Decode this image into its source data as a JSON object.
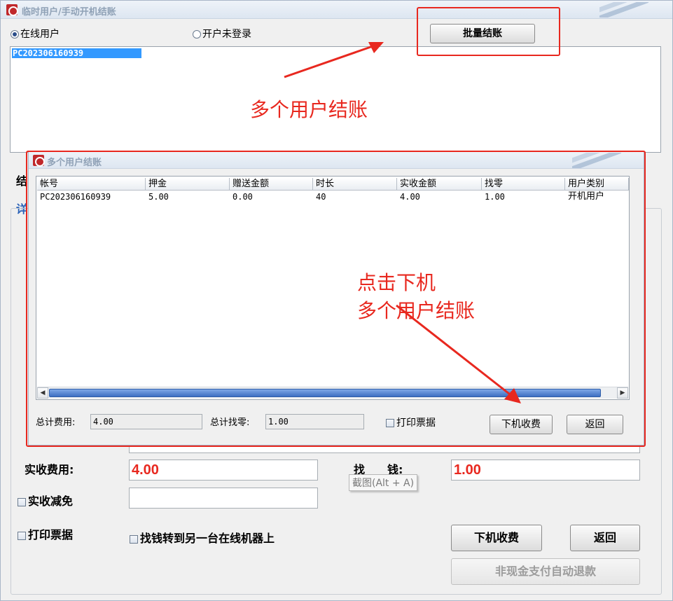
{
  "window": {
    "title": "临时用户/手动开机结账"
  },
  "filters": {
    "online_users": "在线用户",
    "not_logged_in": "开户未登录"
  },
  "batch_button": "批量结账",
  "user_list": [
    "PC202306160939"
  ],
  "annotations": {
    "multi_checkout": "多个用户结账",
    "click_logout_line1": "点击下机",
    "click_logout_line2": "多个用户结账"
  },
  "bg_labels": {
    "partial_1": "结",
    "partial_2": "详"
  },
  "form": {
    "actual_fee_label": "实收费用:",
    "actual_fee_value": "4.00",
    "change_label": "找　　钱:",
    "change_value": "1.00",
    "waive_label": "实收减免",
    "print_receipt_label": "打印票据",
    "transfer_change_label": "找钱转到另一台在线机器上",
    "logout_button": "下机收费",
    "back_button": "返回",
    "non_cash_refund_button": "非现金支付自动退款"
  },
  "tooltip": "截图(Alt + A)",
  "dialog": {
    "title": "多个用户结账",
    "columns": [
      "帐号",
      "押金",
      "赠送金额",
      "时长",
      "实收金额",
      "找零",
      "用户类别"
    ],
    "rows": [
      [
        "PC202306160939",
        "5.00",
        "0.00",
        "40",
        "4.00",
        "1.00",
        "开机用户"
      ]
    ],
    "total_fee_label": "总计费用:",
    "total_fee_value": "4.00",
    "total_change_label": "总计找零:",
    "total_change_value": "1.00",
    "print_receipt_label": "打印票据",
    "logout_button": "下机收费",
    "back_button": "返回"
  },
  "colors": {
    "annotation_red": "#e8281f",
    "selection_blue": "#3399ff",
    "scroll_thumb": "#3d6fc2"
  }
}
